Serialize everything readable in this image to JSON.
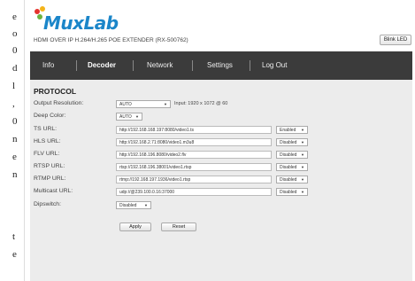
{
  "left_strip": [
    "e",
    "o",
    "0",
    "d",
    "l",
    ",",
    "0",
    "n",
    "e",
    "n",
    "t",
    "e"
  ],
  "header": {
    "logo": "MuxLab",
    "subtitle": "HDMI OVER IP H.264/H.265 POE EXTENDER (RX-500762)",
    "blink_button": "Blink LED"
  },
  "nav": {
    "items": [
      "Info",
      "Decoder",
      "Network",
      "Settings",
      "Log Out"
    ],
    "active": "Decoder"
  },
  "protocol": {
    "title": "PROTOCOL",
    "output_resolution": {
      "label": "Output Resolution:",
      "value": "AUTO",
      "input_note": "Input: 1920 x 1072 @ 60"
    },
    "deep_color": {
      "label": "Deep Color:",
      "value": "AUTO"
    },
    "ts_url": {
      "label": "TS URL:",
      "value": "http://192.168.168.197:8080/video1.ts",
      "status": "Enabled"
    },
    "hls_url": {
      "label": "HLS URL:",
      "value": "http://192.168.2.71:8080/video1.m3u8",
      "status": "Disabled"
    },
    "flv_url": {
      "label": "FLV URL:",
      "value": "http://192.168.196.8080/video2.flv",
      "status": "Disabled"
    },
    "rtsp_url": {
      "label": "RTSP URL:",
      "value": "rtsp://192.168.196.38001/video1.rtsp",
      "status": "Disabled"
    },
    "rtmp_url": {
      "label": "RTMP URL:",
      "value": "rtmp://192.168.197.1936/video1.rtsp",
      "status": "Disabled"
    },
    "multicast_url": {
      "label": "Multicast URL:",
      "value": "udp://@239.100.0.16:37000",
      "status": "Disabled"
    },
    "dipswitch": {
      "label": "Dipswitch:",
      "value": "Disabled"
    },
    "apply_label": "Apply",
    "reset_label": "Reset"
  },
  "colors": {
    "brand": "#1b86c9",
    "navbar": "#3b3b3b",
    "content_bg": "#ececec"
  }
}
